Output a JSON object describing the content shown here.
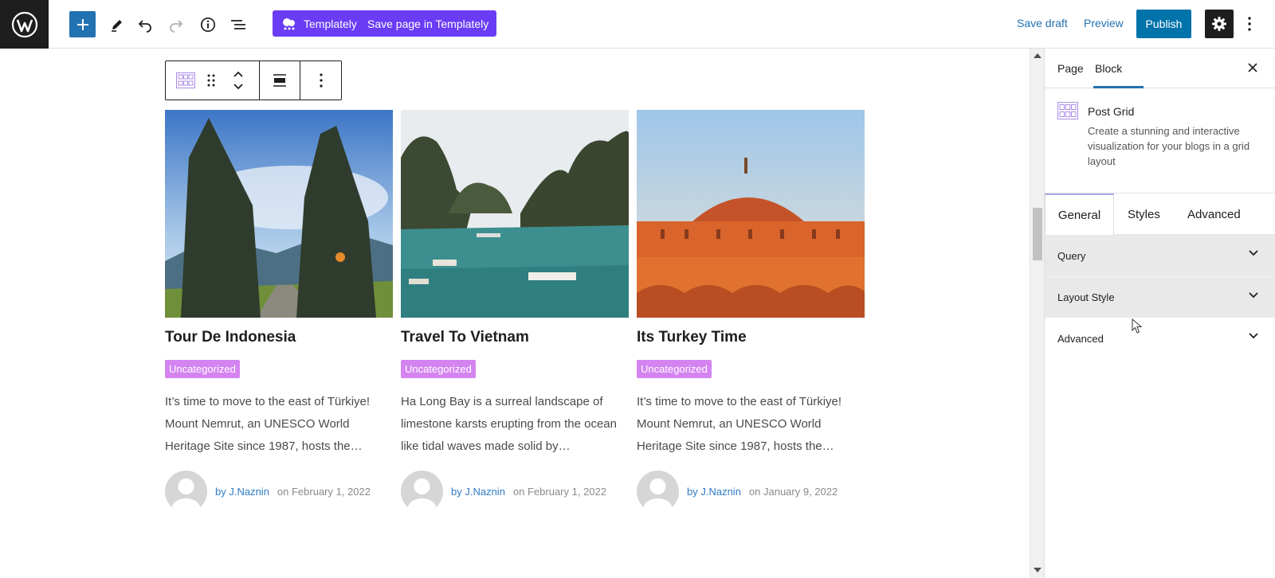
{
  "toolbar": {
    "templately_label": "Templately",
    "save_templately_label": "Save page in Templately",
    "save_draft_label": "Save draft",
    "preview_label": "Preview",
    "publish_label": "Publish"
  },
  "posts": [
    {
      "title": "Tour De Indonesia",
      "category": "Uncategorized",
      "excerpt": "It’s time to move to the east of Türkiye! Mount Nemrut, an UNESCO World Heritage Site since 1987, hosts the…",
      "author": "by J.Naznin",
      "date": "on February 1, 2022"
    },
    {
      "title": "Travel To Vietnam",
      "category": "Uncategorized",
      "excerpt": "Ha Long Bay is a surreal landscape of limestone karsts erupting from the ocean like tidal waves made solid by…",
      "author": "by J.Naznin",
      "date": "on February 1, 2022"
    },
    {
      "title": "Its Turkey Time",
      "category": "Uncategorized",
      "excerpt": "It’s time to move to the east of Türkiye! Mount Nemrut, an UNESCO World Heritage Site since 1987, hosts the…",
      "author": "by J.Naznin",
      "date": "on January 9, 2022"
    }
  ],
  "sidebar": {
    "tabs": [
      "Page",
      "Block"
    ],
    "active_tab": "Block",
    "block": {
      "name": "Post Grid",
      "description": "Create a stunning and interactive visualization for your blogs in a grid layout"
    },
    "panel_tabs": [
      "General",
      "Styles",
      "Advanced"
    ],
    "active_panel_tab": "General",
    "sections": [
      "Query",
      "Layout Style",
      "Advanced"
    ]
  },
  "colors": {
    "accent": "#2271b1",
    "templately": "#6a3cf5",
    "badge": "#d484f0",
    "dark": "#1e1e1e"
  }
}
